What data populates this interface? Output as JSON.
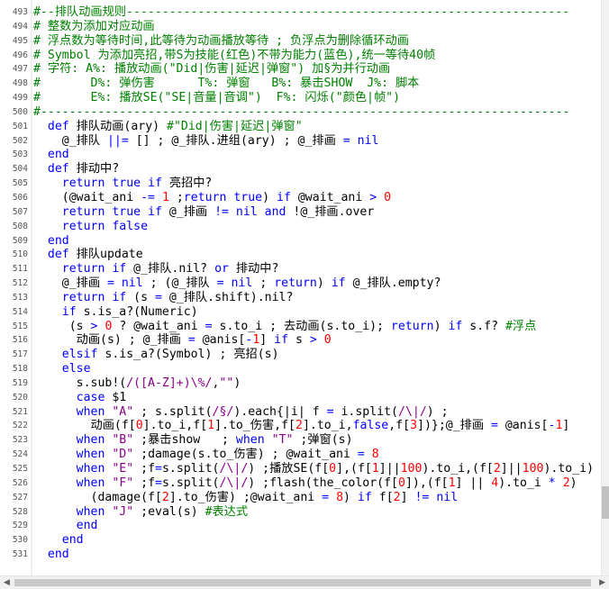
{
  "editor": {
    "lines": [
      {
        "n": "493",
        "segs": [
          [
            "cm",
            "#--排队动画规则--------------------------------------------------------------"
          ]
        ]
      },
      {
        "n": "494",
        "segs": [
          [
            "cm",
            "# 整数为添加对应动画"
          ]
        ]
      },
      {
        "n": "495",
        "segs": [
          [
            "cm",
            "# 浮点数为等待时间,此等待为动画播放等待 ; 负浮点为删除循环动画"
          ]
        ]
      },
      {
        "n": "496",
        "segs": [
          [
            "cm",
            "# Symbol 为添加亮招,带S为技能(红色)不带为能力(蓝色),统一等待40帧"
          ]
        ]
      },
      {
        "n": "497",
        "segs": [
          [
            "cm",
            "# 字符: A%: 播放动画(\"Did|伤害|延迟|弹窗\") 加§为并行动画"
          ]
        ]
      },
      {
        "n": "498",
        "segs": [
          [
            "cm",
            "#       D%: 弹伤害      T%: 弹窗   B%: 暴击SHOW  J%: 脚本"
          ]
        ]
      },
      {
        "n": "499",
        "segs": [
          [
            "cm",
            "#       E%: 播放SE(\"SE|音量|音调\")  F%: 闪烁(\"颜色|帧\")"
          ]
        ]
      },
      {
        "n": "500",
        "segs": [
          [
            "cm",
            "#--------------------------------------------------------------------------"
          ]
        ]
      },
      {
        "n": "501",
        "segs": [
          [
            "pl",
            "  "
          ],
          [
            "kw",
            "def"
          ],
          [
            "pl",
            " 排队动画(ary) "
          ],
          [
            "cm",
            "#\"Did|伤害|延迟|弹窗\""
          ]
        ]
      },
      {
        "n": "502",
        "segs": [
          [
            "pl",
            "    @_排队 "
          ],
          [
            "op",
            "||="
          ],
          [
            "pl",
            " [] ; @_排队.进组(ary) ; @_排画 "
          ],
          [
            "op",
            "="
          ],
          [
            "pl",
            " "
          ],
          [
            "kw",
            "nil"
          ]
        ]
      },
      {
        "n": "503",
        "segs": [
          [
            "pl",
            "  "
          ],
          [
            "kw",
            "end"
          ]
        ]
      },
      {
        "n": "504",
        "segs": [
          [
            "pl",
            "  "
          ],
          [
            "kw",
            "def"
          ],
          [
            "pl",
            " 排动中?"
          ]
        ]
      },
      {
        "n": "505",
        "segs": [
          [
            "pl",
            "    "
          ],
          [
            "kw",
            "return true if"
          ],
          [
            "pl",
            " 亮招中?"
          ]
        ]
      },
      {
        "n": "506",
        "segs": [
          [
            "pl",
            "    (@wait_ani "
          ],
          [
            "op",
            "-="
          ],
          [
            "pl",
            " "
          ],
          [
            "nm",
            "1"
          ],
          [
            "pl",
            " ;"
          ],
          [
            "kw",
            "return true"
          ],
          [
            "pl",
            ") "
          ],
          [
            "kw",
            "if"
          ],
          [
            "pl",
            " @wait_ani "
          ],
          [
            "op",
            ">"
          ],
          [
            "pl",
            " "
          ],
          [
            "nm",
            "0"
          ]
        ]
      },
      {
        "n": "507",
        "segs": [
          [
            "pl",
            "    "
          ],
          [
            "kw",
            "return true if"
          ],
          [
            "pl",
            " @_排画 "
          ],
          [
            "op",
            "!="
          ],
          [
            "pl",
            " "
          ],
          [
            "kw",
            "nil and"
          ],
          [
            "pl",
            " !@_排画.over"
          ]
        ]
      },
      {
        "n": "508",
        "segs": [
          [
            "pl",
            "    "
          ],
          [
            "kw",
            "return false"
          ]
        ]
      },
      {
        "n": "509",
        "segs": [
          [
            "pl",
            "  "
          ],
          [
            "kw",
            "end"
          ]
        ]
      },
      {
        "n": "510",
        "segs": [
          [
            "pl",
            "  "
          ],
          [
            "kw",
            "def"
          ],
          [
            "pl",
            " 排队update"
          ]
        ]
      },
      {
        "n": "511",
        "segs": [
          [
            "pl",
            "    "
          ],
          [
            "kw",
            "return if"
          ],
          [
            "pl",
            " @_排队.nil? "
          ],
          [
            "kw",
            "or"
          ],
          [
            "pl",
            " 排动中?"
          ]
        ]
      },
      {
        "n": "512",
        "segs": [
          [
            "pl",
            "    @_排画 "
          ],
          [
            "op",
            "="
          ],
          [
            "pl",
            " "
          ],
          [
            "kw",
            "nil"
          ],
          [
            "pl",
            " ; (@_排队 "
          ],
          [
            "op",
            "="
          ],
          [
            "pl",
            " "
          ],
          [
            "kw",
            "nil"
          ],
          [
            "pl",
            " ; "
          ],
          [
            "kw",
            "return"
          ],
          [
            "pl",
            ") "
          ],
          [
            "kw",
            "if"
          ],
          [
            "pl",
            " @_排队.empty?"
          ]
        ]
      },
      {
        "n": "513",
        "segs": [
          [
            "pl",
            "    "
          ],
          [
            "kw",
            "return if"
          ],
          [
            "pl",
            " (s "
          ],
          [
            "op",
            "="
          ],
          [
            "pl",
            " @_排队.shift).nil?"
          ]
        ]
      },
      {
        "n": "514",
        "segs": [
          [
            "pl",
            "    "
          ],
          [
            "kw",
            "if"
          ],
          [
            "pl",
            " s.is_a?(Numeric)"
          ]
        ]
      },
      {
        "n": "515",
        "segs": [
          [
            "pl",
            "     (s "
          ],
          [
            "op",
            ">"
          ],
          [
            "pl",
            " "
          ],
          [
            "nm",
            "0"
          ],
          [
            "pl",
            " ? @wait_ani "
          ],
          [
            "op",
            "="
          ],
          [
            "pl",
            " s.to_i ; 去动画(s.to_i); "
          ],
          [
            "kw",
            "return"
          ],
          [
            "pl",
            ") "
          ],
          [
            "kw",
            "if"
          ],
          [
            "pl",
            " s.f? "
          ],
          [
            "cm",
            "#浮点"
          ]
        ]
      },
      {
        "n": "516",
        "segs": [
          [
            "pl",
            "      动画(s) ; @_排画 "
          ],
          [
            "op",
            "="
          ],
          [
            "pl",
            " @anis["
          ],
          [
            "op",
            "-"
          ],
          [
            "nm",
            "1"
          ],
          [
            "pl",
            "] "
          ],
          [
            "kw",
            "if"
          ],
          [
            "pl",
            " s "
          ],
          [
            "op",
            ">"
          ],
          [
            "pl",
            " "
          ],
          [
            "nm",
            "0"
          ]
        ]
      },
      {
        "n": "517",
        "segs": [
          [
            "pl",
            "    "
          ],
          [
            "kw",
            "elsif"
          ],
          [
            "pl",
            " s.is_a?(Symbol) ; 亮招(s)"
          ]
        ]
      },
      {
        "n": "518",
        "segs": [
          [
            "pl",
            "    "
          ],
          [
            "kw",
            "else"
          ]
        ]
      },
      {
        "n": "519",
        "segs": [
          [
            "pl",
            "      s.sub!("
          ],
          [
            "st",
            "/([A-Z]+)\\%/"
          ],
          [
            "pl",
            ","
          ],
          [
            "st",
            "\"\""
          ],
          [
            "pl",
            ")"
          ]
        ]
      },
      {
        "n": "520",
        "segs": [
          [
            "pl",
            "      "
          ],
          [
            "kw",
            "case"
          ],
          [
            "pl",
            " $1"
          ]
        ]
      },
      {
        "n": "521",
        "segs": [
          [
            "pl",
            "      "
          ],
          [
            "kw",
            "when"
          ],
          [
            "pl",
            " "
          ],
          [
            "st",
            "\"A\""
          ],
          [
            "pl",
            " ; s.split("
          ],
          [
            "st",
            "/§/"
          ],
          [
            "pl",
            ").each{|i| f "
          ],
          [
            "op",
            "="
          ],
          [
            "pl",
            " i.split("
          ],
          [
            "st",
            "/\\|/"
          ],
          [
            "pl",
            ") ;"
          ]
        ]
      },
      {
        "n": "522",
        "segs": [
          [
            "pl",
            "        动画(f["
          ],
          [
            "nm",
            "0"
          ],
          [
            "pl",
            "].to_i,f["
          ],
          [
            "nm",
            "1"
          ],
          [
            "pl",
            "].to_伤害,f["
          ],
          [
            "nm",
            "2"
          ],
          [
            "pl",
            "].to_i,"
          ],
          [
            "kw",
            "false"
          ],
          [
            "pl",
            ",f["
          ],
          [
            "nm",
            "3"
          ],
          [
            "pl",
            "])};@_排画 "
          ],
          [
            "op",
            "="
          ],
          [
            "pl",
            " @anis["
          ],
          [
            "op",
            "-"
          ],
          [
            "nm",
            "1"
          ],
          [
            "pl",
            "]"
          ]
        ]
      },
      {
        "n": "523",
        "segs": [
          [
            "pl",
            "      "
          ],
          [
            "kw",
            "when"
          ],
          [
            "pl",
            " "
          ],
          [
            "st",
            "\"B\""
          ],
          [
            "pl",
            " ;暴击show   ; "
          ],
          [
            "kw",
            "when"
          ],
          [
            "pl",
            " "
          ],
          [
            "st",
            "\"T\""
          ],
          [
            "pl",
            " ;弹窗(s)"
          ]
        ]
      },
      {
        "n": "524",
        "segs": [
          [
            "pl",
            "      "
          ],
          [
            "kw",
            "when"
          ],
          [
            "pl",
            " "
          ],
          [
            "st",
            "\"D\""
          ],
          [
            "pl",
            " ;damage(s.to_伤害) ; @wait_ani "
          ],
          [
            "op",
            "="
          ],
          [
            "pl",
            " "
          ],
          [
            "nm",
            "8"
          ]
        ]
      },
      {
        "n": "525",
        "segs": [
          [
            "pl",
            "      "
          ],
          [
            "kw",
            "when"
          ],
          [
            "pl",
            " "
          ],
          [
            "st",
            "\"E\""
          ],
          [
            "pl",
            " ;f"
          ],
          [
            "op",
            "="
          ],
          [
            "pl",
            "s.split("
          ],
          [
            "st",
            "/\\|/"
          ],
          [
            "pl",
            ") ;播放SE(f["
          ],
          [
            "nm",
            "0"
          ],
          [
            "pl",
            "],(f["
          ],
          [
            "nm",
            "1"
          ],
          [
            "pl",
            "]||"
          ],
          [
            "nm",
            "100"
          ],
          [
            "pl",
            ").to_i,(f["
          ],
          [
            "nm",
            "2"
          ],
          [
            "pl",
            "]||"
          ],
          [
            "nm",
            "100"
          ],
          [
            "pl",
            ").to_i)"
          ]
        ]
      },
      {
        "n": "526",
        "segs": [
          [
            "pl",
            "      "
          ],
          [
            "kw",
            "when"
          ],
          [
            "pl",
            " "
          ],
          [
            "st",
            "\"F\""
          ],
          [
            "pl",
            " ;f"
          ],
          [
            "op",
            "="
          ],
          [
            "pl",
            "s.split("
          ],
          [
            "st",
            "/\\|/"
          ],
          [
            "pl",
            ") ;flash(the_color(f["
          ],
          [
            "nm",
            "0"
          ],
          [
            "pl",
            "]),(f["
          ],
          [
            "nm",
            "1"
          ],
          [
            "pl",
            "] || "
          ],
          [
            "nm",
            "4"
          ],
          [
            "pl",
            ").to_i "
          ],
          [
            "op",
            "*"
          ],
          [
            "pl",
            " "
          ],
          [
            "nm",
            "2"
          ],
          [
            "pl",
            ")"
          ]
        ]
      },
      {
        "n": "527",
        "segs": [
          [
            "pl",
            "        (damage(f["
          ],
          [
            "nm",
            "2"
          ],
          [
            "pl",
            "].to_伤害) ;@wait_ani "
          ],
          [
            "op",
            "="
          ],
          [
            "pl",
            " "
          ],
          [
            "nm",
            "8"
          ],
          [
            "pl",
            ") "
          ],
          [
            "kw",
            "if"
          ],
          [
            "pl",
            " f["
          ],
          [
            "nm",
            "2"
          ],
          [
            "pl",
            "] "
          ],
          [
            "op",
            "!="
          ],
          [
            "pl",
            " "
          ],
          [
            "kw",
            "nil"
          ]
        ]
      },
      {
        "n": "528",
        "segs": [
          [
            "pl",
            "      "
          ],
          [
            "kw",
            "when"
          ],
          [
            "pl",
            " "
          ],
          [
            "st",
            "\"J\""
          ],
          [
            "pl",
            " ;eval(s) "
          ],
          [
            "cm",
            "#表达式"
          ]
        ]
      },
      {
        "n": "529",
        "segs": [
          [
            "pl",
            "      "
          ],
          [
            "kw",
            "end"
          ]
        ]
      },
      {
        "n": "530",
        "segs": [
          [
            "pl",
            "    "
          ],
          [
            "kw",
            "end"
          ]
        ]
      },
      {
        "n": "531",
        "segs": [
          [
            "pl",
            "  "
          ],
          [
            "kw",
            "end"
          ]
        ]
      }
    ]
  },
  "scrollbar": {
    "left_arrow": "◀",
    "right_arrow": "▶"
  },
  "colors": {
    "keyword": "#0000ff",
    "comment": "#008000",
    "string": "#8b008b",
    "number": "#ff0000"
  }
}
